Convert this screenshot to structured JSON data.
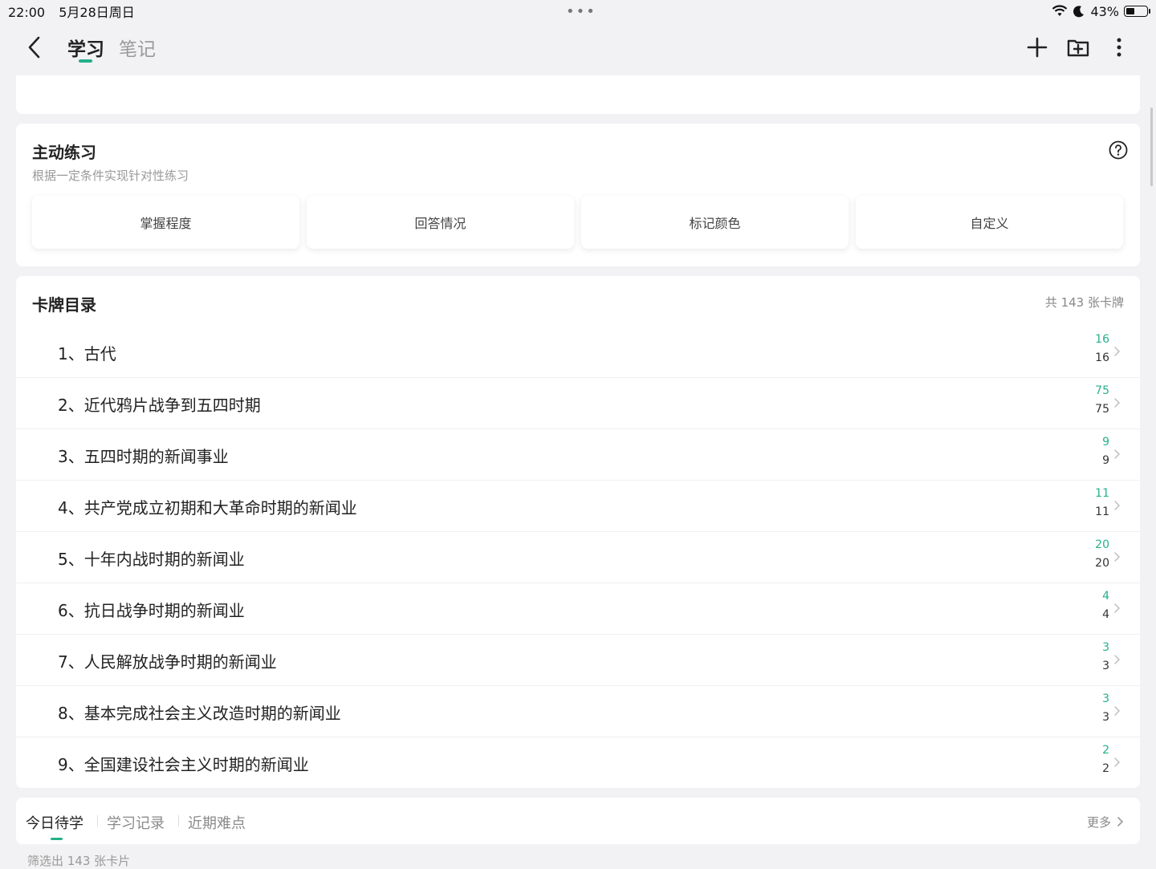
{
  "status_bar": {
    "time": "22:00",
    "date": "5月28日周日",
    "battery_text": "43%",
    "battery_level": 0.43,
    "icons": [
      "wifi-icon",
      "moon-icon",
      "battery-icon"
    ]
  },
  "nav": {
    "tabs": [
      {
        "label": "学习",
        "active": true
      },
      {
        "label": "笔记",
        "active": false
      }
    ],
    "icons": [
      "back-arrow-icon",
      "plus-icon",
      "folder-add-icon",
      "more-vertical-icon"
    ]
  },
  "practice": {
    "title": "主动练习",
    "subtitle": "根据一定条件实现针对性练习",
    "buttons": [
      "掌握程度",
      "回答情况",
      "标记颜色",
      "自定义"
    ]
  },
  "catalog": {
    "title": "卡牌目录",
    "total": "共 143 张卡牌",
    "items": [
      {
        "name": "1、古代",
        "count_top": "16",
        "count_bottom": "16"
      },
      {
        "name": "2、近代鸦片战争到五四时期",
        "count_top": "75",
        "count_bottom": "75"
      },
      {
        "name": "3、五四时期的新闻事业",
        "count_top": "9",
        "count_bottom": "9"
      },
      {
        "name": "4、共产党成立初期和大革命时期的新闻业",
        "count_top": "11",
        "count_bottom": "11"
      },
      {
        "name": "5、十年内战时期的新闻业",
        "count_top": "20",
        "count_bottom": "20"
      },
      {
        "name": "6、抗日战争时期的新闻业",
        "count_top": "4",
        "count_bottom": "4"
      },
      {
        "name": "7、人民解放战争时期的新闻业",
        "count_top": "3",
        "count_bottom": "3"
      },
      {
        "name": "8、基本完成社会主义改造时期的新闻业",
        "count_top": "3",
        "count_bottom": "3"
      },
      {
        "name": "9、全国建设社会主义时期的新闻业",
        "count_top": "2",
        "count_bottom": "2"
      }
    ]
  },
  "bottom_tabs": {
    "tabs": [
      "今日待学",
      "学习记录",
      "近期难点"
    ],
    "more": "更多"
  },
  "filter_text": "筛选出 143 张卡片",
  "colors": {
    "accent": "#25b08b",
    "background": "#f2f2f4",
    "card": "#ffffff"
  }
}
